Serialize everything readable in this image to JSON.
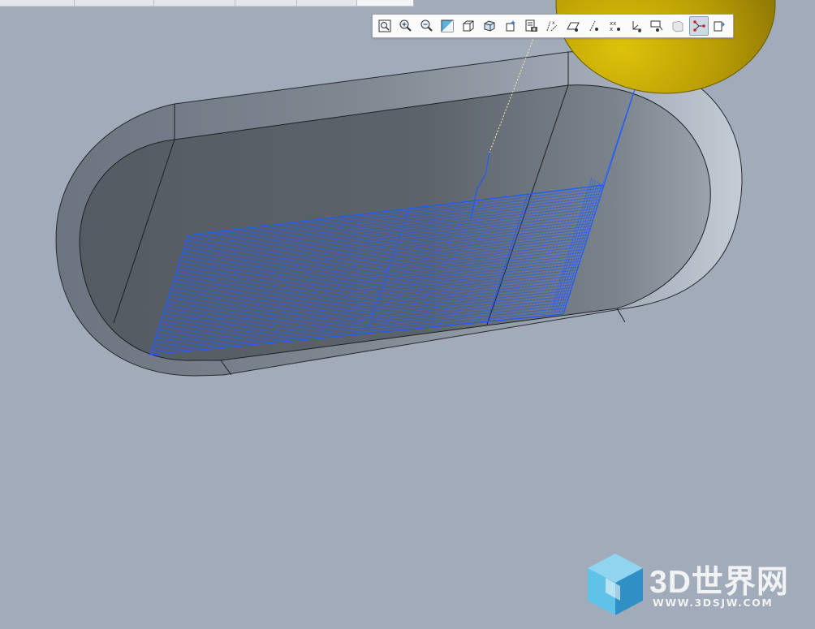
{
  "tabs": [
    "",
    "",
    "",
    "",
    "",
    ""
  ],
  "toolbar": {
    "tools": [
      {
        "name": "zoom-fit-icon"
      },
      {
        "name": "zoom-in-icon"
      },
      {
        "name": "zoom-out-icon"
      },
      {
        "name": "repaint-icon"
      },
      {
        "name": "display-style-icon"
      },
      {
        "name": "saved-views-icon"
      },
      {
        "name": "view-manager-icon"
      },
      {
        "name": "perspective-icon"
      },
      {
        "name": "datum-display-icon"
      },
      {
        "name": "plane-display-icon"
      },
      {
        "name": "axis-display-icon"
      },
      {
        "name": "point-display-icon"
      },
      {
        "name": "csys-display-icon"
      },
      {
        "name": "annotation-display-icon"
      },
      {
        "name": "spin-center-icon"
      },
      {
        "name": "toolpath-display-icon",
        "active": true
      },
      {
        "name": "play-path-icon"
      }
    ]
  },
  "watermark": {
    "brand": "3D世界网",
    "url": "WWW.3DSJW.COM",
    "cube_color_light": "#5cc3ea",
    "cube_color_dark": "#2a8ec6"
  },
  "colors": {
    "background": "#a1abb9",
    "toolpath": "#1f5cff",
    "tool_holder": "#c9ad05",
    "pocket_floor": "#5a6068"
  }
}
